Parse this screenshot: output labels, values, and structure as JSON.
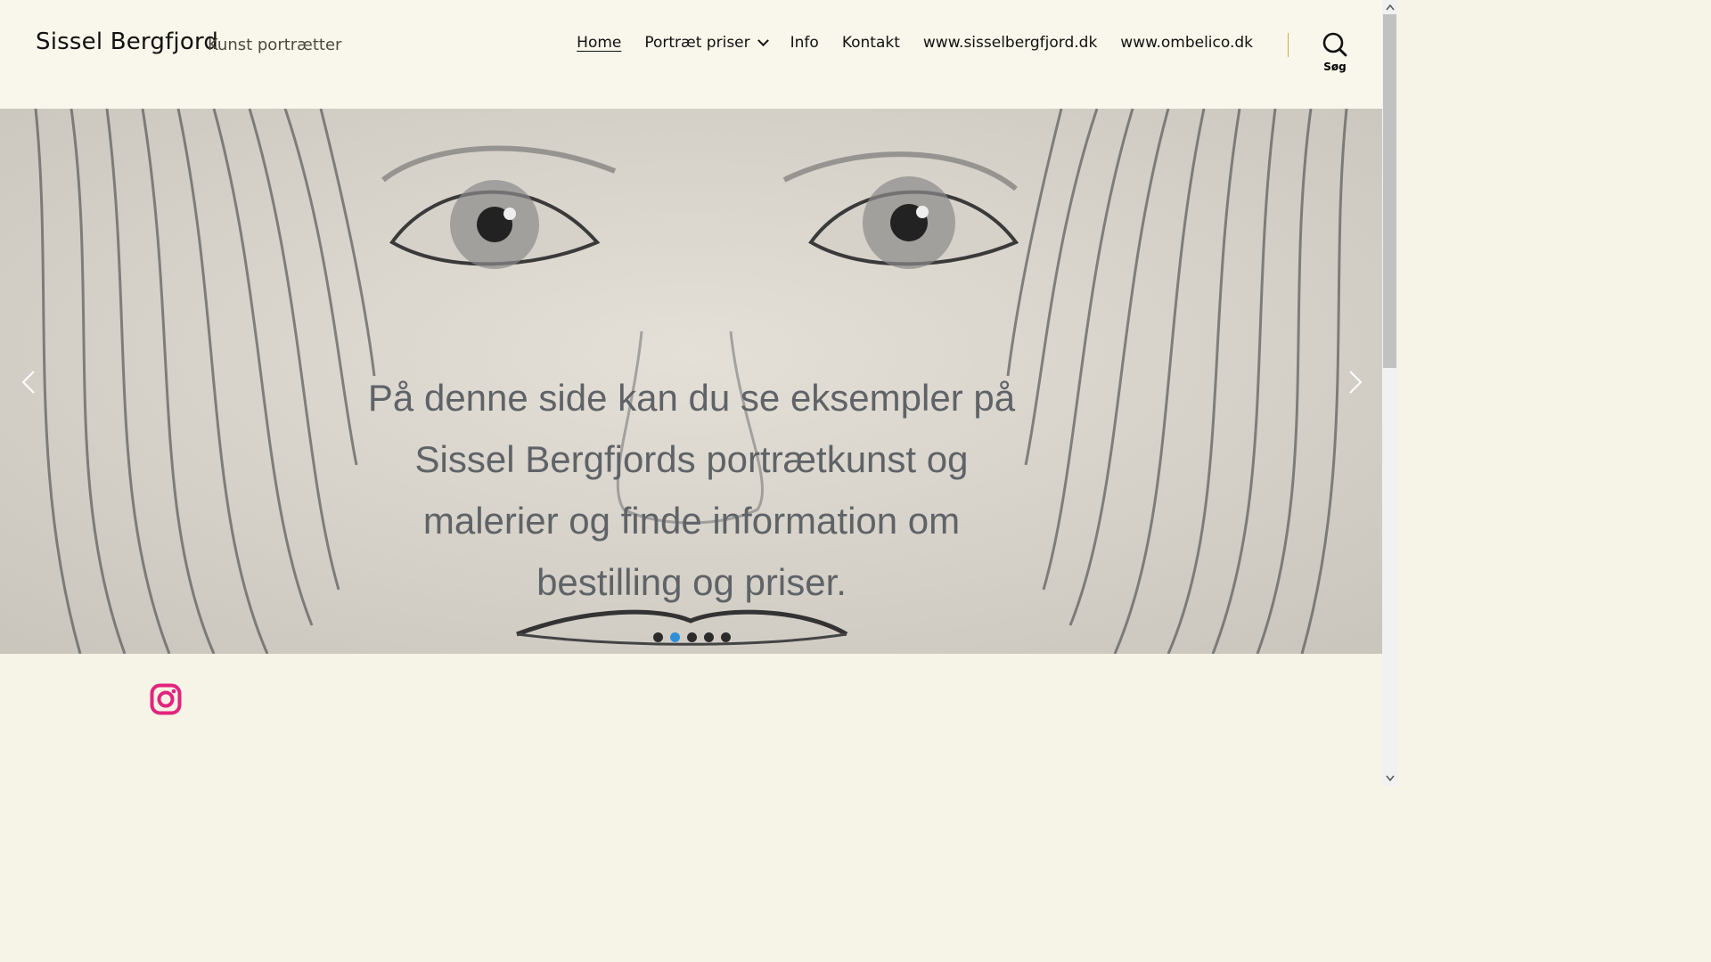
{
  "header": {
    "site_title": "Sissel Bergfjord",
    "tagline": "Kunst portrætter",
    "nav": [
      {
        "label": "Home",
        "active": true
      },
      {
        "label": "Portræt priser",
        "has_dropdown": true
      },
      {
        "label": "Info"
      },
      {
        "label": "Kontakt"
      },
      {
        "label": "www.sisselbergfjord.dk"
      },
      {
        "label": "www.ombelico.dk"
      }
    ],
    "search_label": "Søg"
  },
  "hero": {
    "text": "På denne side kan du se eksempler på Sissel Bergfjords portrætkunst og malerier og finde information om bestilling og priser.",
    "slide_count": 5,
    "active_slide": 2
  },
  "social": {
    "icon": "instagram-icon",
    "color": "#e2247f"
  },
  "colors": {
    "background": "#f6f4e6",
    "accent_divider": "#d7a94a",
    "active_dot": "#2e8fd8"
  }
}
